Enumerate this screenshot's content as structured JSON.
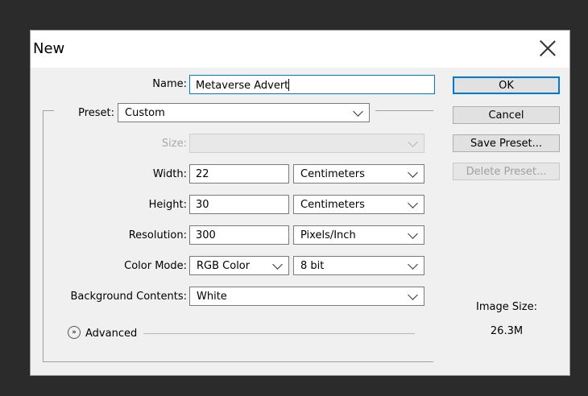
{
  "dialog": {
    "title": "New",
    "name_label": "Name:",
    "name_value": "Metaverse Advert",
    "preset_label": "Preset:",
    "preset_value": "Custom",
    "size_label": "Size:",
    "size_value": "",
    "width_label": "Width:",
    "width_value": "22",
    "width_unit": "Centimeters",
    "height_label": "Height:",
    "height_value": "30",
    "height_unit": "Centimeters",
    "resolution_label": "Resolution:",
    "resolution_value": "300",
    "resolution_unit": "Pixels/Inch",
    "color_mode_label": "Color Mode:",
    "color_mode_value": "RGB Color",
    "bit_depth_value": "8 bit",
    "background_label": "Background Contents:",
    "background_value": "White",
    "advanced_label": "Advanced",
    "image_size_label": "Image Size:",
    "image_size_value": "26.3M"
  },
  "buttons": {
    "ok": "OK",
    "cancel": "Cancel",
    "save_preset": "Save Preset...",
    "delete_preset": "Delete Preset..."
  },
  "icons": {
    "close": "close-icon",
    "dropdown": "chevron-down-icon",
    "advanced": "expand-circle-icon"
  },
  "colors": {
    "accent": "#0078d7",
    "dialog_bg": "#f0f0f0",
    "backdrop": "#2b2b2b"
  }
}
